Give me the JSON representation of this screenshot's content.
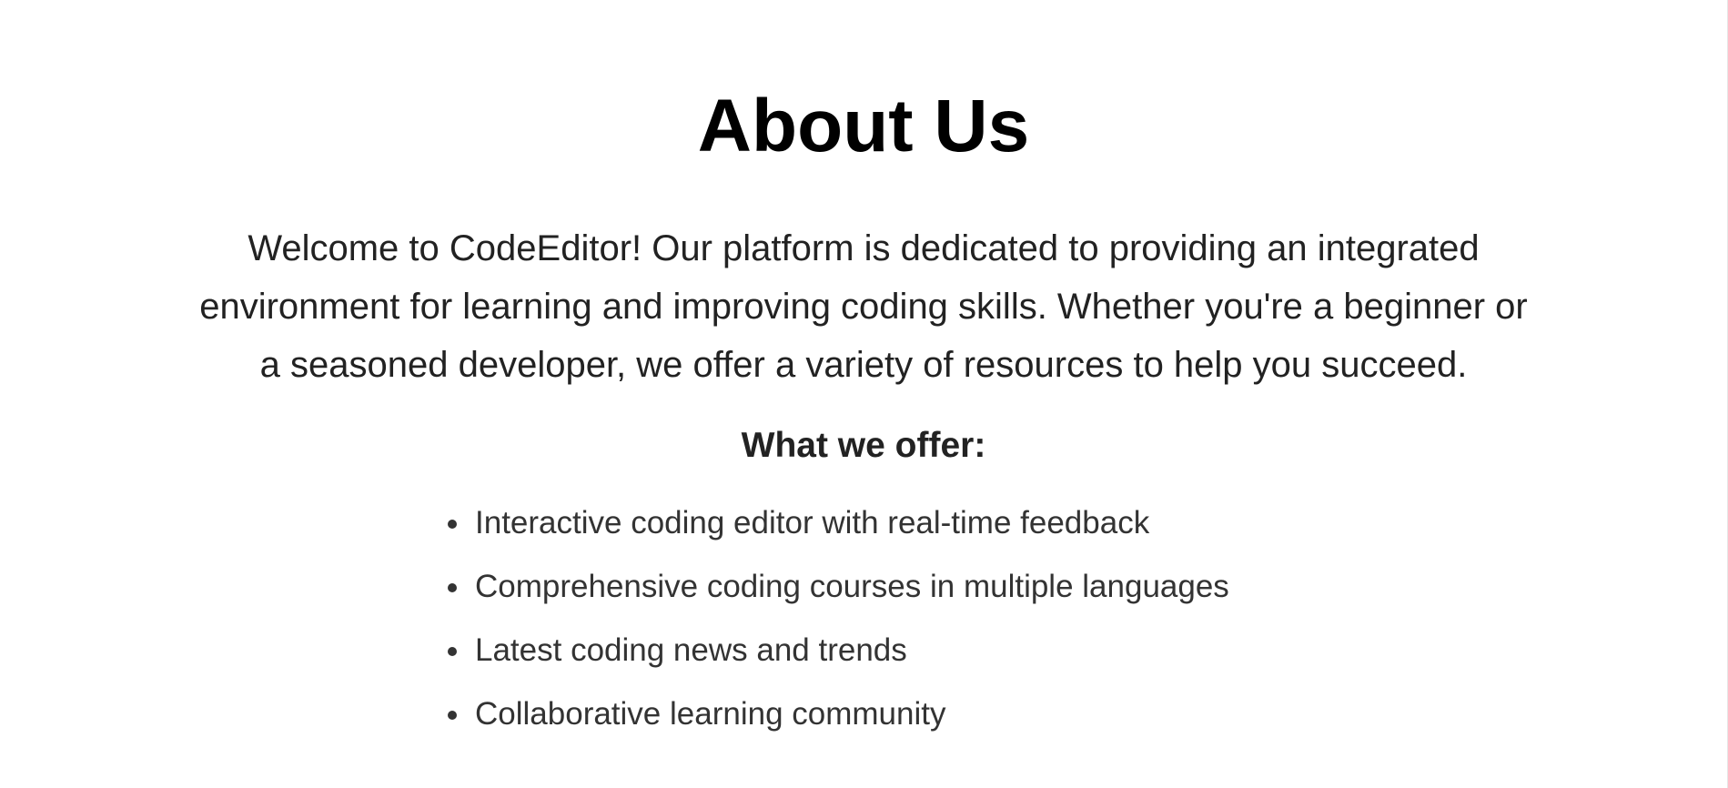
{
  "about": {
    "title": "About Us",
    "intro": "Welcome to CodeEditor! Our platform is dedicated to providing an integrated environment for learning and improving coding skills. Whether you're a beginner or a seasoned developer, we offer a variety of resources to help you succeed.",
    "offer_heading": "What we offer:",
    "offers": [
      "Interactive coding editor with real-time feedback",
      "Comprehensive coding courses in multiple languages",
      "Latest coding news and trends",
      "Collaborative learning community"
    ]
  },
  "colors": {
    "background": "#ffffff",
    "title": "#000000",
    "body_text": "#222222",
    "list_text": "#333333"
  }
}
